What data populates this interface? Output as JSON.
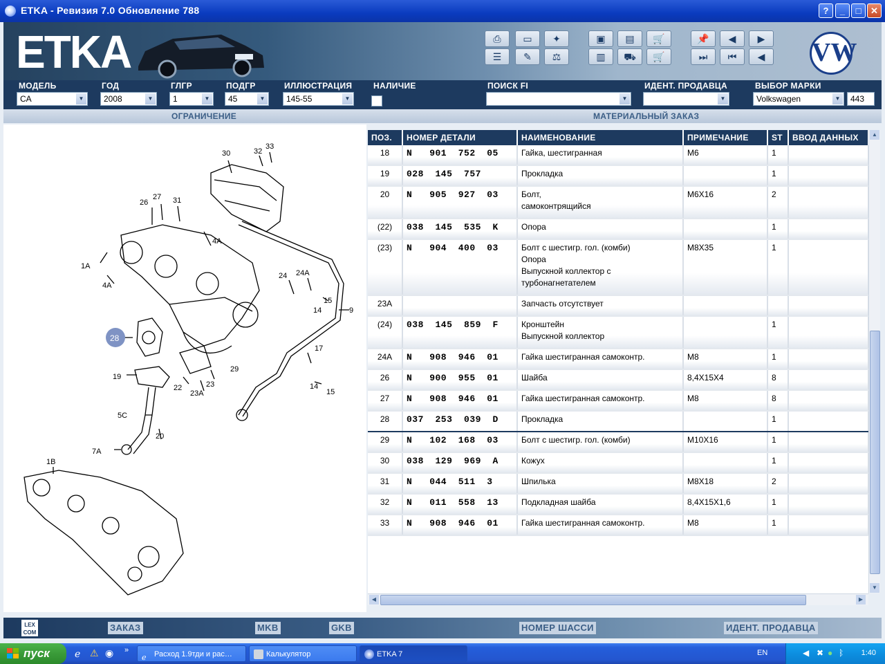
{
  "window": {
    "title": "ETKA - Ревизия 7.0 Обновление 788",
    "buttons": [
      "?",
      "_",
      "□",
      "✕"
    ]
  },
  "header": {
    "logo_text": "ETKA",
    "brand_logo": "VW"
  },
  "filters": {
    "model_label": "МОДЕЛЬ",
    "model_value": "CA",
    "year_label": "ГОД",
    "year_value": "2008",
    "main_group_label": "ГЛГР",
    "main_group_value": "1",
    "sub_group_label": "ПОДГР",
    "sub_group_value": "45",
    "illustration_label": "ИЛЛЮСТРАЦИЯ",
    "illustration_value": "145-55",
    "availability_label": "НАЛИЧИЕ",
    "search_label": "ПОИСК FI",
    "search_value": "",
    "dealer_label": "ИДЕНТ. ПРОДАВЦА",
    "dealer_value": "",
    "brand_label": "ВЫБОР МАРКИ",
    "brand_value": "Volkswagen",
    "brand_code": "443"
  },
  "subbar": {
    "restriction": "ОГРАНИЧЕНИЕ",
    "material_order": "МАТЕРИАЛЬНЫЙ ЗАКАЗ"
  },
  "table": {
    "headers": [
      "ПОЗ.",
      "НОМЕР ДЕТАЛИ",
      "НАИМЕНОВАНИЕ",
      "ПРИМЕЧАНИЕ",
      "ST",
      "ВВОД ДАННЫХ"
    ],
    "rows": [
      {
        "pos": "18",
        "part": "N   901  752  05",
        "name": "Гайка, шестигранная",
        "note": "M6",
        "st": "1"
      },
      {
        "pos": "19",
        "part": "028  145  757",
        "name": "Прокладка",
        "note": "",
        "st": "1"
      },
      {
        "pos": "20",
        "part": "N   905  927  03",
        "name": "Болт,\nсамоконтрящийся",
        "note": "M6X16",
        "st": "2"
      },
      {
        "pos": "(22)",
        "part": "038  145  535  K",
        "name": "Опора",
        "note": "",
        "st": "1"
      },
      {
        "pos": "(23)",
        "part": "N   904  400  03",
        "name": "Болт с шестигр. гол. (комби)\nОпора\nВыпускной коллектор с\nтурбонагнетателем",
        "note": "M8X35",
        "st": "1"
      },
      {
        "pos": "23A",
        "part": "",
        "name": "Запчасть отсутствует",
        "note": "",
        "st": ""
      },
      {
        "pos": "(24)",
        "part": "038  145  859  F",
        "name": "Кронштейн\nВыпускной коллектор",
        "note": "",
        "st": "1"
      },
      {
        "pos": "24A",
        "part": "N   908  946  01",
        "name": "Гайка шестигранная самоконтр.",
        "note": "M8",
        "st": "1"
      },
      {
        "pos": "26",
        "part": "N   900  955  01",
        "name": "Шайба",
        "note": "8,4X15X4",
        "st": "8"
      },
      {
        "pos": "27",
        "part": "N   908  946  01",
        "name": "Гайка шестигранная самоконтр.",
        "note": "M8",
        "st": "8"
      },
      {
        "pos": "28",
        "part": "037  253  039  D",
        "name": "Прокладка",
        "note": "",
        "st": "1",
        "selected": true
      },
      {
        "pos": "29",
        "part": "N   102  168  03",
        "name": "Болт с шестигр. гол. (комби)",
        "note": "M10X16",
        "st": "1"
      },
      {
        "pos": "30",
        "part": "038  129  969  A",
        "name": "Кожух",
        "note": "",
        "st": "1"
      },
      {
        "pos": "31",
        "part": "N   044  511  3",
        "name": "Шпилька",
        "note": "M8X18",
        "st": "2"
      },
      {
        "pos": "32",
        "part": "N   011  558  13",
        "name": "Подкладная шайба",
        "note": "8,4X15X1,6",
        "st": "1"
      },
      {
        "pos": "33",
        "part": "N   908  946  01",
        "name": "Гайка шестигранная самоконтр.",
        "note": "M8",
        "st": "1"
      }
    ]
  },
  "illustration": {
    "callouts": [
      "30",
      "32",
      "33",
      "26",
      "27",
      "31",
      "4A",
      "1A",
      "4A",
      "24",
      "24A",
      "15",
      "9",
      "14",
      "28",
      "17",
      "19",
      "22",
      "23",
      "29",
      "14",
      "15",
      "23A",
      "5C",
      "20",
      "7A",
      "1B"
    ],
    "highlighted": "28"
  },
  "bottombar": {
    "lexcom": "LEX COM",
    "order": "ЗАКАЗ",
    "mkb": "MKB",
    "gkb": "GKB",
    "chassis": "НОМЕР ШАССИ",
    "dealer": "ИДЕНТ. ПРОДАВЦА"
  },
  "taskbar": {
    "start": "пуск",
    "tasks": [
      "Расход 1.9тди и рас…",
      "Калькулятор",
      "ETKA 7"
    ],
    "lang": "EN",
    "clock": "1:40"
  }
}
